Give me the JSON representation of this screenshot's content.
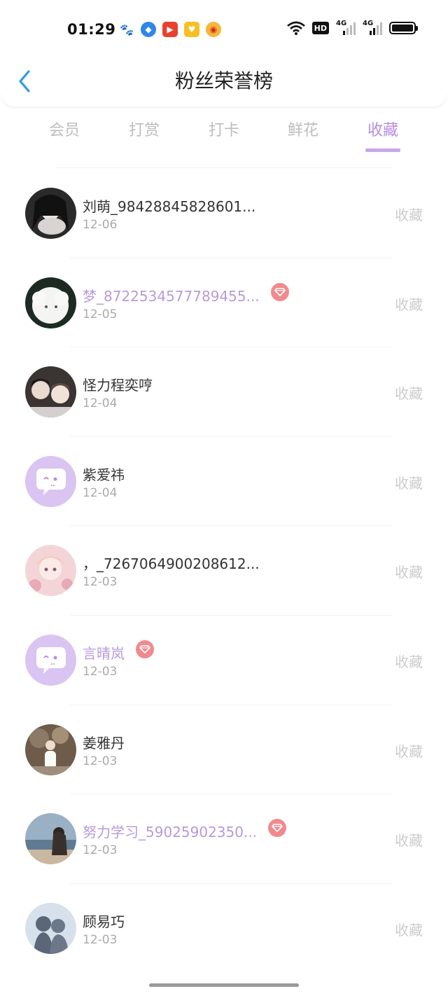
{
  "status_bar": {
    "time": "01:29",
    "app_icons": [
      "baidu-icon",
      "browser-icon",
      "video-play-icon",
      "coupon-icon",
      "weibo-icon"
    ],
    "hd_label": "HD",
    "signal1_label": "4G",
    "signal2_label": "4G"
  },
  "header": {
    "title": "粉丝荣誉榜"
  },
  "tabs": [
    {
      "label": "会员",
      "active": false
    },
    {
      "label": "打赏",
      "active": false
    },
    {
      "label": "打卡",
      "active": false
    },
    {
      "label": "鲜花",
      "active": false
    },
    {
      "label": "收藏",
      "active": true
    }
  ],
  "colors": {
    "accent": "#b48ee3",
    "vip_name": "#b89ad9",
    "badge": "#f08a8e",
    "back_arrow": "#2f9be8"
  },
  "fans": [
    {
      "name": "刘萌_98428845828601...",
      "date": "12-06",
      "action": "收藏",
      "vip": false,
      "avatar": "dark"
    },
    {
      "name": "梦_8722534577789455...",
      "date": "12-05",
      "action": "收藏",
      "vip": true,
      "avatar": "sheep"
    },
    {
      "name": "怪力程奕哼",
      "date": "12-04",
      "action": "收藏",
      "vip": false,
      "avatar": "couple"
    },
    {
      "name": "紫爱祎",
      "date": "12-04",
      "action": "收藏",
      "vip": false,
      "avatar": "default"
    },
    {
      "name": "，_7267064900208612...",
      "date": "12-03",
      "action": "收藏",
      "vip": false,
      "avatar": "pink"
    },
    {
      "name": "言晴岚",
      "date": "12-03",
      "action": "收藏",
      "vip": true,
      "avatar": "default"
    },
    {
      "name": "姜雅丹",
      "date": "12-03",
      "action": "收藏",
      "vip": false,
      "avatar": "tree"
    },
    {
      "name": "努力学习_59025902350...",
      "date": "12-03",
      "action": "收藏",
      "vip": true,
      "avatar": "sea"
    },
    {
      "name": "顾易巧",
      "date": "12-03",
      "action": "收藏",
      "vip": false,
      "avatar": "silhouette"
    }
  ]
}
